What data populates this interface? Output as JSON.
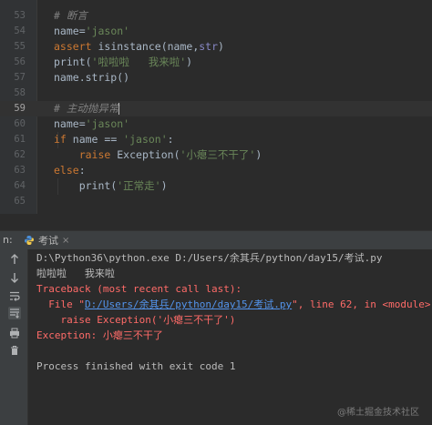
{
  "editor": {
    "lines": [
      {
        "num": "53",
        "cm": "# 断言"
      },
      {
        "num": "54",
        "a": "name",
        "b": "=",
        "s": "'jason'"
      },
      {
        "num": "55",
        "a": "assert",
        "b": " isinstance(name,",
        "c": "str",
        "d": ")"
      },
      {
        "num": "56",
        "a": "print(",
        "s": "'啦啦啦   我来啦'",
        "d": ")"
      },
      {
        "num": "57",
        "a": "name.strip()"
      },
      {
        "num": "58"
      },
      {
        "num": "59",
        "cm": "# 主动抛异常"
      },
      {
        "num": "60",
        "a": "name",
        "b": "=",
        "s": "'jason'"
      },
      {
        "num": "61",
        "kw": "if",
        "a": " name == ",
        "s": "'jason'",
        "d": ":"
      },
      {
        "num": "62",
        "kw": "raise",
        "a": " Exception(",
        "s": "'小瘪三不干了'",
        "d": ")"
      },
      {
        "num": "63",
        "kw": "else",
        "d": ":"
      },
      {
        "num": "64",
        "a": "print(",
        "s": "'正常走'",
        "d": ")"
      },
      {
        "num": "65"
      }
    ]
  },
  "runbar": {
    "prefix": "n:",
    "tab_label": "考试"
  },
  "console": {
    "command": "D:\\Python36\\python.exe D:/Users/余其兵/python/day15/考试.py",
    "output1": "啦啦啦   我来啦",
    "traceback": "Traceback (most recent call last):",
    "file_prefix": "  File \"",
    "file_link": "D:/Users/余其兵/python/day15/考试.py",
    "file_suffix": "\", line 62, in <module>",
    "raise_line": "    raise Exception('小瘪三不干了')",
    "exception": "Exception: 小瘪三不干了",
    "finished": "Process finished with exit code 1"
  },
  "watermark": "@稀土掘金技术社区",
  "colors": {
    "background": "#2b2b2b",
    "keyword": "#cc7832",
    "string": "#6a8759",
    "comment": "#808080",
    "error": "#ff6b68",
    "link": "#5394ec"
  }
}
